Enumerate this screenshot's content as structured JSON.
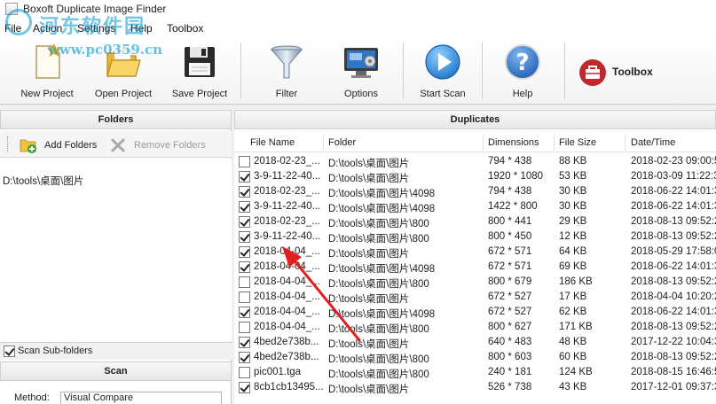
{
  "window": {
    "title": "Boxoft Duplicate Image Finder"
  },
  "menu": [
    "File",
    "Action",
    "Settings",
    "Help",
    "Toolbox"
  ],
  "watermark": {
    "line1": "河东软件园",
    "line2": "www.pc0359.cn"
  },
  "toolbar": {
    "new_project": "New Project",
    "open_project": "Open Project",
    "save_project": "Save Project",
    "filter": "Filter",
    "options": "Options",
    "start_scan": "Start Scan",
    "help": "Help",
    "toolbox": "Toolbox"
  },
  "left": {
    "folders_title": "Folders",
    "add_folders": "Add Folders",
    "remove_folders": "Remove Folders",
    "folder_path": "D:\\tools\\桌面\\图片",
    "scan_subfolders": "Scan Sub-folders",
    "scan_subfolders_checked": true,
    "scan_title": "Scan",
    "method_label": "Method:",
    "method_value": "Visual Compare"
  },
  "right": {
    "title": "Duplicates",
    "columns": [
      "File Name",
      "Folder",
      "Dimensions",
      "File Size",
      "Date/Time"
    ],
    "rows": [
      {
        "checked": false,
        "name": "2018-02-23_...",
        "folder": "D:\\tools\\桌面\\图片",
        "dim": "794 * 438",
        "size": "88 KB",
        "date": "2018-02-23 09:00:5"
      },
      {
        "checked": true,
        "name": "3-9-11-22-40...",
        "folder": "D:\\tools\\桌面\\图片",
        "dim": "1920 * 1080",
        "size": "53 KB",
        "date": "2018-03-09 11:22:3"
      },
      {
        "checked": true,
        "name": "2018-02-23_...",
        "folder": "D:\\tools\\桌面\\图片\\4098",
        "dim": "794 * 438",
        "size": "30 KB",
        "date": "2018-06-22 14:01:3"
      },
      {
        "checked": true,
        "name": "3-9-11-22-40...",
        "folder": "D:\\tools\\桌面\\图片\\4098",
        "dim": "1422 * 800",
        "size": "30 KB",
        "date": "2018-06-22 14:01:3"
      },
      {
        "checked": true,
        "name": "2018-02-23_...",
        "folder": "D:\\tools\\桌面\\图片\\800",
        "dim": "800 * 441",
        "size": "29 KB",
        "date": "2018-08-13 09:52:2"
      },
      {
        "checked": true,
        "name": "3-9-11-22-40...",
        "folder": "D:\\tools\\桌面\\图片\\800",
        "dim": "800 * 450",
        "size": "12 KB",
        "date": "2018-08-13 09:52:2"
      },
      {
        "checked": true,
        "name": "2018-04-04_...",
        "folder": "D:\\tools\\桌面\\图片",
        "dim": "672 * 571",
        "size": "64 KB",
        "date": "2018-05-29 17:58:0"
      },
      {
        "checked": true,
        "name": "2018-04-04_...",
        "folder": "D:\\tools\\桌面\\图片\\4098",
        "dim": "672 * 571",
        "size": "69 KB",
        "date": "2018-06-22 14:01:3"
      },
      {
        "checked": false,
        "name": "2018-04-04_...",
        "folder": "D:\\tools\\桌面\\图片\\800",
        "dim": "800 * 679",
        "size": "186 KB",
        "date": "2018-08-13 09:52:2"
      },
      {
        "checked": false,
        "name": "2018-04-04_...",
        "folder": "D:\\tools\\桌面\\图片",
        "dim": "672 * 527",
        "size": "17 KB",
        "date": "2018-04-04 10:20:2"
      },
      {
        "checked": true,
        "name": "2018-04-04_...",
        "folder": "D:\\tools\\桌面\\图片\\4098",
        "dim": "672 * 527",
        "size": "62 KB",
        "date": "2018-06-22 14:01:3"
      },
      {
        "checked": false,
        "name": "2018-04-04_...",
        "folder": "D:\\tools\\桌面\\图片\\800",
        "dim": "800 * 627",
        "size": "171 KB",
        "date": "2018-08-13 09:52:2"
      },
      {
        "checked": true,
        "name": "4bed2e738b...",
        "folder": "D:\\tools\\桌面\\图片",
        "dim": "640 * 483",
        "size": "48 KB",
        "date": "2017-12-22 10:04:3"
      },
      {
        "checked": true,
        "name": "4bed2e738b...",
        "folder": "D:\\tools\\桌面\\图片\\800",
        "dim": "800 * 603",
        "size": "60 KB",
        "date": "2018-08-13 09:52:2"
      },
      {
        "checked": false,
        "name": "pic001.tga",
        "folder": "D:\\tools\\桌面\\图片\\800",
        "dim": "240 * 181",
        "size": "124 KB",
        "date": "2018-08-15 16:46:5"
      },
      {
        "checked": true,
        "name": "8cb1cb13495...",
        "folder": "D:\\tools\\桌面\\图片",
        "dim": "526 * 738",
        "size": "43 KB",
        "date": "2017-12-01 09:37:3"
      }
    ]
  },
  "colors": {
    "arrow": "#e02020",
    "watermark": "#0096d2",
    "help": "#1d6fc4",
    "scan": "#1a8be0"
  }
}
